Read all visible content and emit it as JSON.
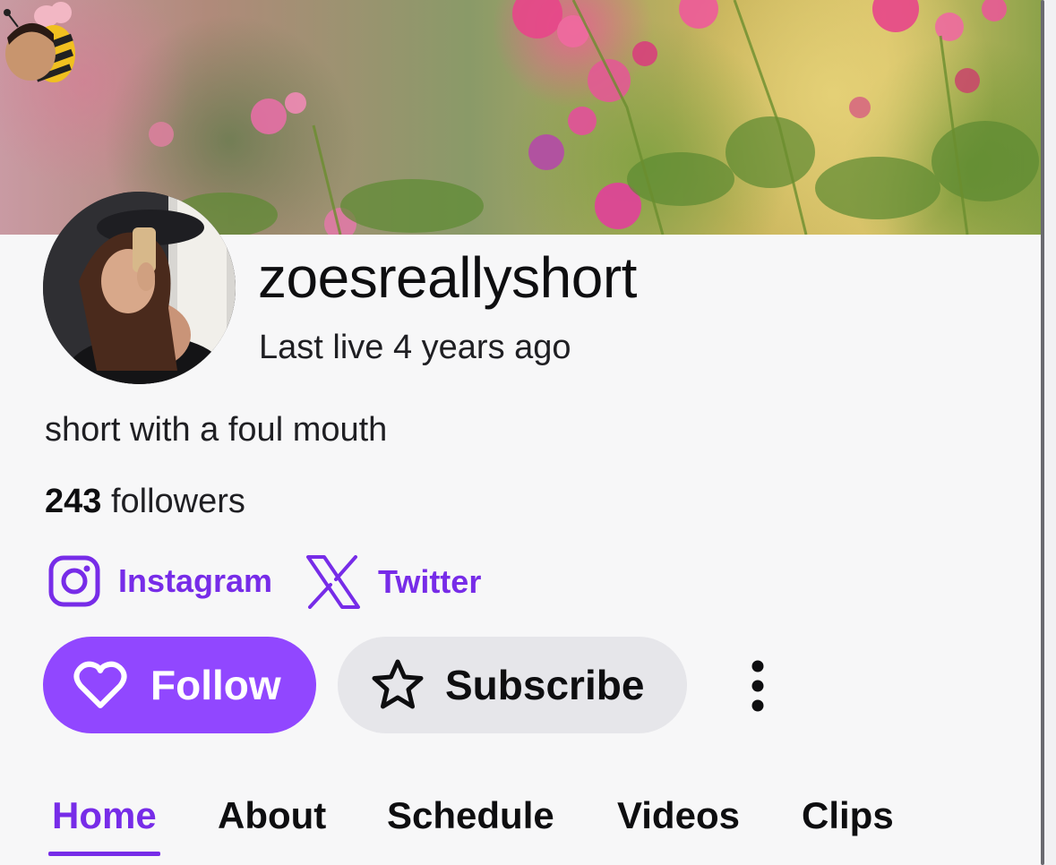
{
  "profile": {
    "username": "zoesreallyshort",
    "last_live": "Last live 4 years ago",
    "bio": "short with a foul mouth",
    "followers_count": "243",
    "followers_label": "followers"
  },
  "social_links": [
    {
      "label": "Instagram",
      "icon": "instagram-icon"
    },
    {
      "label": "Twitter",
      "icon": "x-icon"
    }
  ],
  "actions": {
    "follow_label": "Follow",
    "subscribe_label": "Subscribe"
  },
  "tabs": [
    {
      "label": "Home",
      "active": true
    },
    {
      "label": "About",
      "active": false
    },
    {
      "label": "Schedule",
      "active": false
    },
    {
      "label": "Videos",
      "active": false
    },
    {
      "label": "Clips",
      "active": false
    }
  ],
  "colors": {
    "accent": "#772ce8",
    "follow_button": "#9147ff",
    "subscribe_button": "#e6e6ea",
    "background": "#f7f7f8"
  }
}
